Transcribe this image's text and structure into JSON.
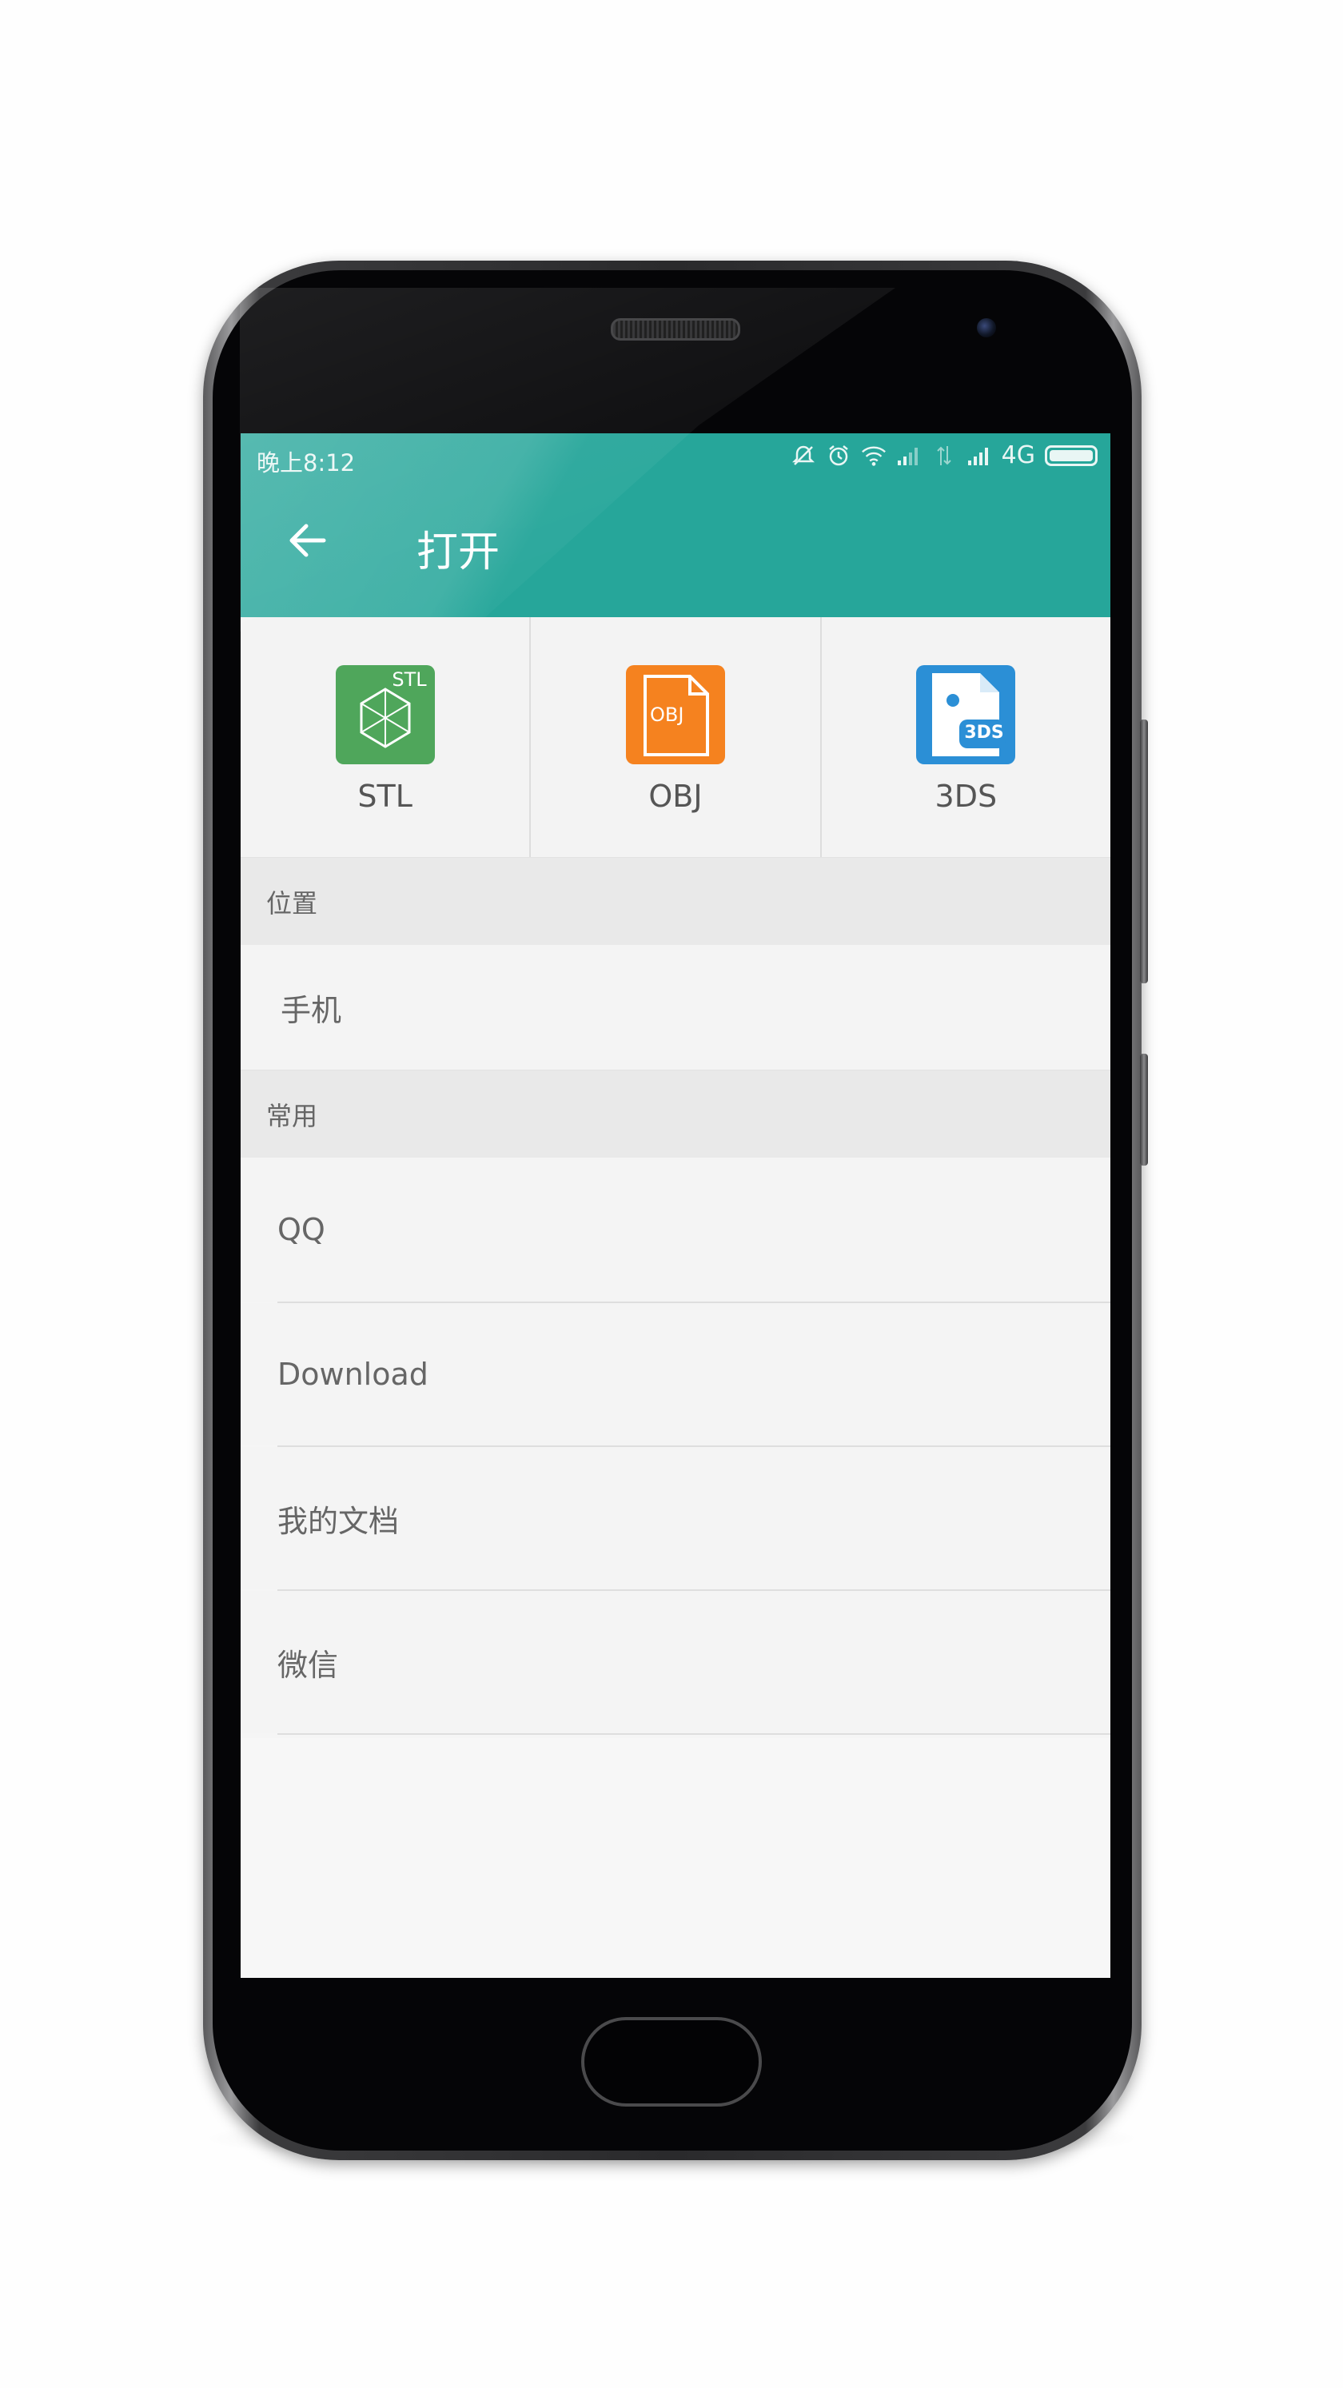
{
  "status_bar": {
    "time": "晚上8:12",
    "network": "4G",
    "icons": [
      "mute-bell-icon",
      "alarm-icon",
      "wifi-icon",
      "signal-icon",
      "data-arrows-icon",
      "signal-icon",
      "battery-icon"
    ]
  },
  "app_bar": {
    "title": "打开",
    "back_icon": "arrow-left-icon"
  },
  "formats": [
    {
      "label": "STL",
      "icon_text": "STL",
      "color": "#4fa65b"
    },
    {
      "label": "OBJ",
      "icon_text": "OBJ",
      "color": "#f5821f"
    },
    {
      "label": "3DS",
      "icon_text": "3DS",
      "color": "#2b8fd6"
    }
  ],
  "sections": {
    "location": {
      "header": "位置",
      "items": [
        "手机"
      ]
    },
    "common": {
      "header": "常用",
      "items": [
        "QQ",
        "Download",
        "我的文档",
        "微信"
      ]
    }
  },
  "colors": {
    "accent": "#26a69a",
    "background": "#f5f5f5",
    "section_header_bg": "#e9e9e9"
  }
}
